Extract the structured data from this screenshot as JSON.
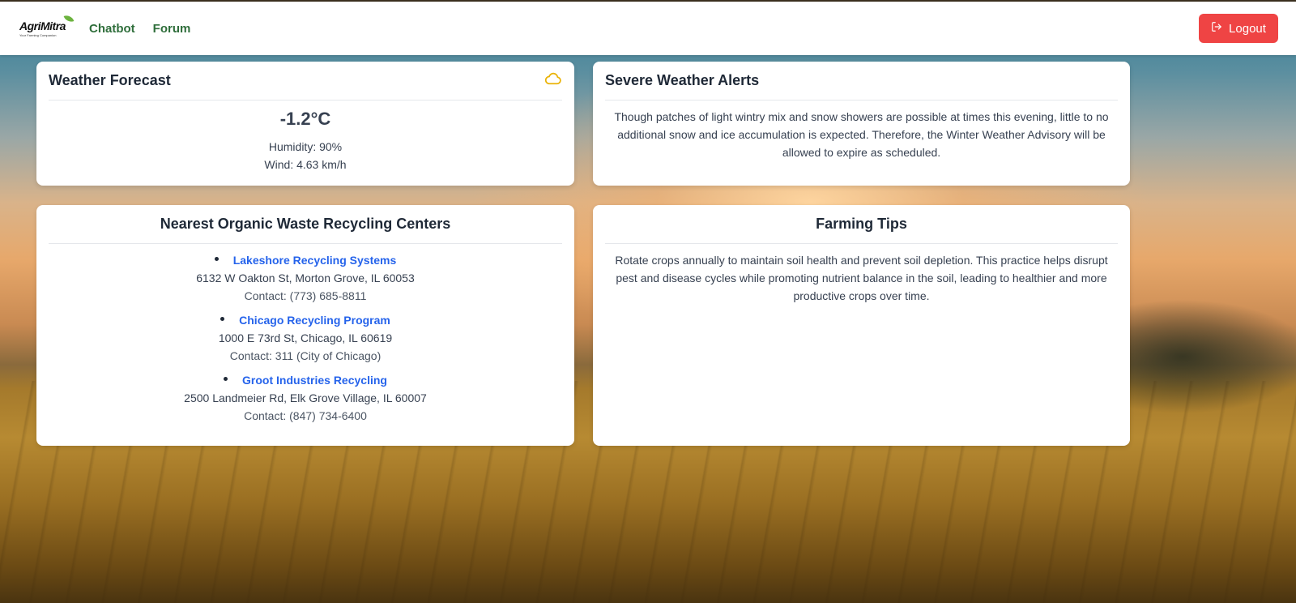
{
  "nav": {
    "logo_name": "AgriMitra",
    "logo_tagline": "Your Farming Companion",
    "links": [
      {
        "label": "Chatbot"
      },
      {
        "label": "Forum"
      }
    ],
    "logout_label": "Logout"
  },
  "weather": {
    "title": "Weather Forecast",
    "icon": "cloud-icon",
    "temperature": "-1.2°C",
    "humidity": "Humidity: 90%",
    "wind": "Wind: 4.63 km/h"
  },
  "alerts": {
    "title": "Severe Weather Alerts",
    "text": "Though patches of light wintry mix and snow showers are possible at times this evening, little to no additional snow and ice accumulation is expected. Therefore, the Winter Weather Advisory will be allowed to expire as scheduled."
  },
  "recycling": {
    "title": "Nearest Organic Waste Recycling Centers",
    "centers": [
      {
        "name": "Lakeshore Recycling Systems",
        "address": "6132 W Oakton St, Morton Grove, IL 60053",
        "contact": "Contact: (773) 685-8811"
      },
      {
        "name": "Chicago Recycling Program",
        "address": "1000 E 73rd St, Chicago, IL 60619",
        "contact": "Contact: 311 (City of Chicago)"
      },
      {
        "name": "Groot Industries Recycling",
        "address": "2500 Landmeier Rd, Elk Grove Village, IL 60007",
        "contact": "Contact: (847) 734-6400"
      }
    ]
  },
  "tips": {
    "title": "Farming Tips",
    "text": "Rotate crops annually to maintain soil health and prevent soil depletion. This practice helps disrupt pest and disease cycles while promoting nutrient balance in the soil, leading to healthier and more productive crops over time."
  },
  "colors": {
    "accent_green": "#2f6e3b",
    "logout_red": "#ef4444",
    "link_blue": "#2563eb",
    "cloud_yellow": "#eab308"
  }
}
